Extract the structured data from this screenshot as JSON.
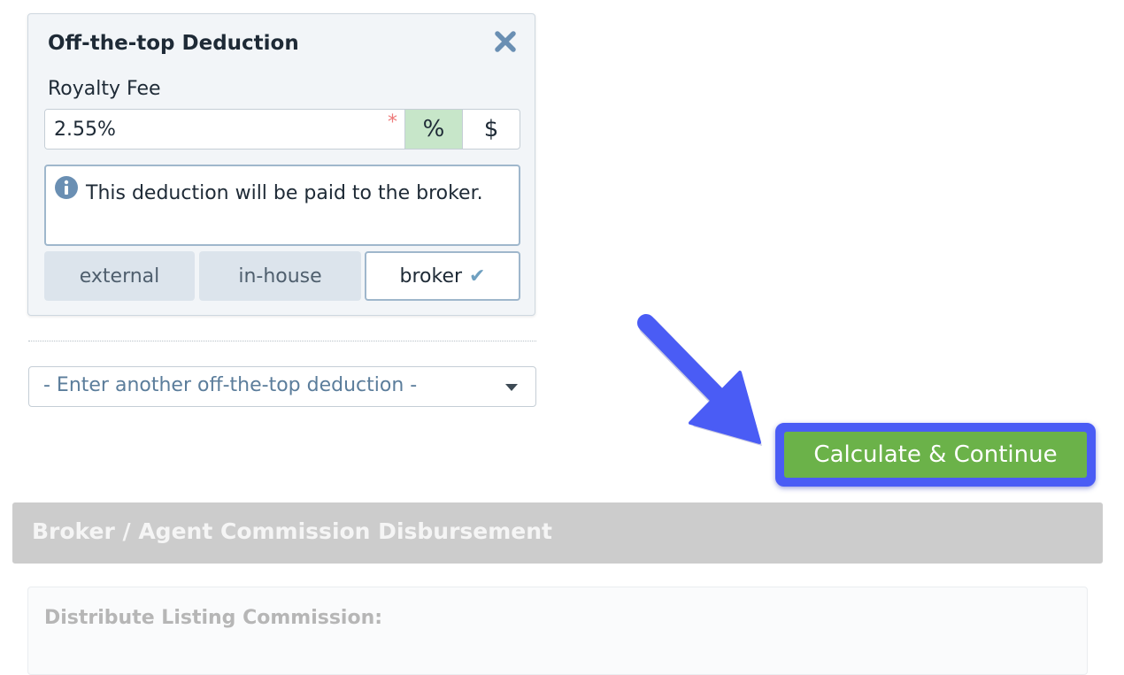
{
  "deduction_card": {
    "title": "Off-the-top Deduction",
    "field_label": "Royalty Fee",
    "rate_value": "2.55%",
    "required_marker": "*",
    "unit_percent": "%",
    "unit_dollar": "$",
    "selected_unit": "percent",
    "info_text": "This deduction will be paid to the broker.",
    "payee_options": [
      "external",
      "in-house",
      "broker"
    ],
    "selected_payee": "broker",
    "close_icon": "close-icon",
    "info_icon": "info-icon",
    "check_icon": "checkmark-icon"
  },
  "add_deduction_select": {
    "selected_text": "- Enter another off-the-top deduction -"
  },
  "calculate_button": {
    "label": "Calculate & Continue"
  },
  "disbursement_section": {
    "title": "Broker / Agent Commission Disbursement",
    "subsection_title": "Distribute Listing Commission:"
  },
  "colors": {
    "accent_green": "#6bb249",
    "highlight_blue": "#4a5cf5",
    "active_unit_bg": "#c7e6c9",
    "section_bar": "#cccccc"
  }
}
